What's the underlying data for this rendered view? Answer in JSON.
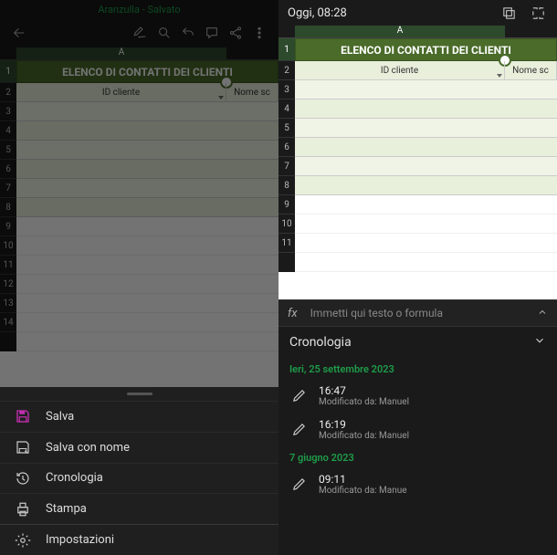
{
  "left": {
    "doc_title": "Aranzulla - Salvato",
    "col_letter": "A",
    "sheet_title": "ELENCO DI CONTATTI DEI CLIENTI",
    "header_id": "ID cliente",
    "header_name": "Nome sc",
    "rows": [
      "1",
      "2",
      "3",
      "4",
      "5",
      "6",
      "7",
      "8",
      "9",
      "10",
      "11",
      "12",
      "13",
      "14"
    ],
    "menu": {
      "save": "Salva",
      "save_as": "Salva con nome",
      "history": "Cronologia",
      "print": "Stampa",
      "settings": "Impostazioni"
    }
  },
  "right": {
    "timestamp": "Oggi, 08:28",
    "col_letter": "A",
    "sheet_title": "ELENCO DI CONTATTI DEI CLIENTI",
    "header_id": "ID cliente",
    "header_name": "Nome sc",
    "rows": [
      "1",
      "2",
      "3",
      "4",
      "5",
      "6",
      "7",
      "8",
      "9",
      "10",
      "11"
    ],
    "fx_placeholder": "Immetti qui testo o formula",
    "history_title": "Cronologia",
    "groups": [
      {
        "date": "Ieri, 25 settembre 2023",
        "items": [
          {
            "time": "16:47",
            "by": "Modificato da: Manuel"
          },
          {
            "time": "16:19",
            "by": "Modificato da: Manuel"
          }
        ]
      },
      {
        "date": "7 giugno 2023",
        "items": [
          {
            "time": "09:11",
            "by": "Modificato da: Manue"
          }
        ]
      }
    ]
  }
}
